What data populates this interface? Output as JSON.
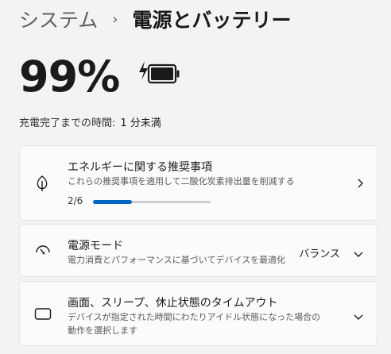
{
  "breadcrumb": {
    "parent": "システム",
    "separator": "›",
    "current": "電源とバッテリー"
  },
  "battery": {
    "percent": "99%",
    "charge_label": "充電完了までの時間:",
    "charge_value": "1 分未満",
    "level": 0.99,
    "charging": true
  },
  "cards": {
    "energy": {
      "title": "エネルギーに関する推奨事項",
      "description": "これらの推奨事項を適用して二酸化炭素排出量を削減する",
      "progress_text": "2/6",
      "progress_fraction": 0.3333,
      "icon": "leaf-icon"
    },
    "power_mode": {
      "title": "電源モード",
      "description": "電力消費とパフォーマンスに基づいてデバイスを最適化",
      "value": "バランス",
      "icon": "power-mode-gauge-icon"
    },
    "screen_sleep": {
      "title": "画面、スリープ、休止状態のタイムアウト",
      "description": "デバイスが指定された時間にわたりアイドル状態になった場合の動作を選択します",
      "icon": "screen-sleep-icon"
    }
  },
  "colors": {
    "accent": "#0067c0",
    "background": "#f3f3f3",
    "card": "#fbfbfb"
  }
}
